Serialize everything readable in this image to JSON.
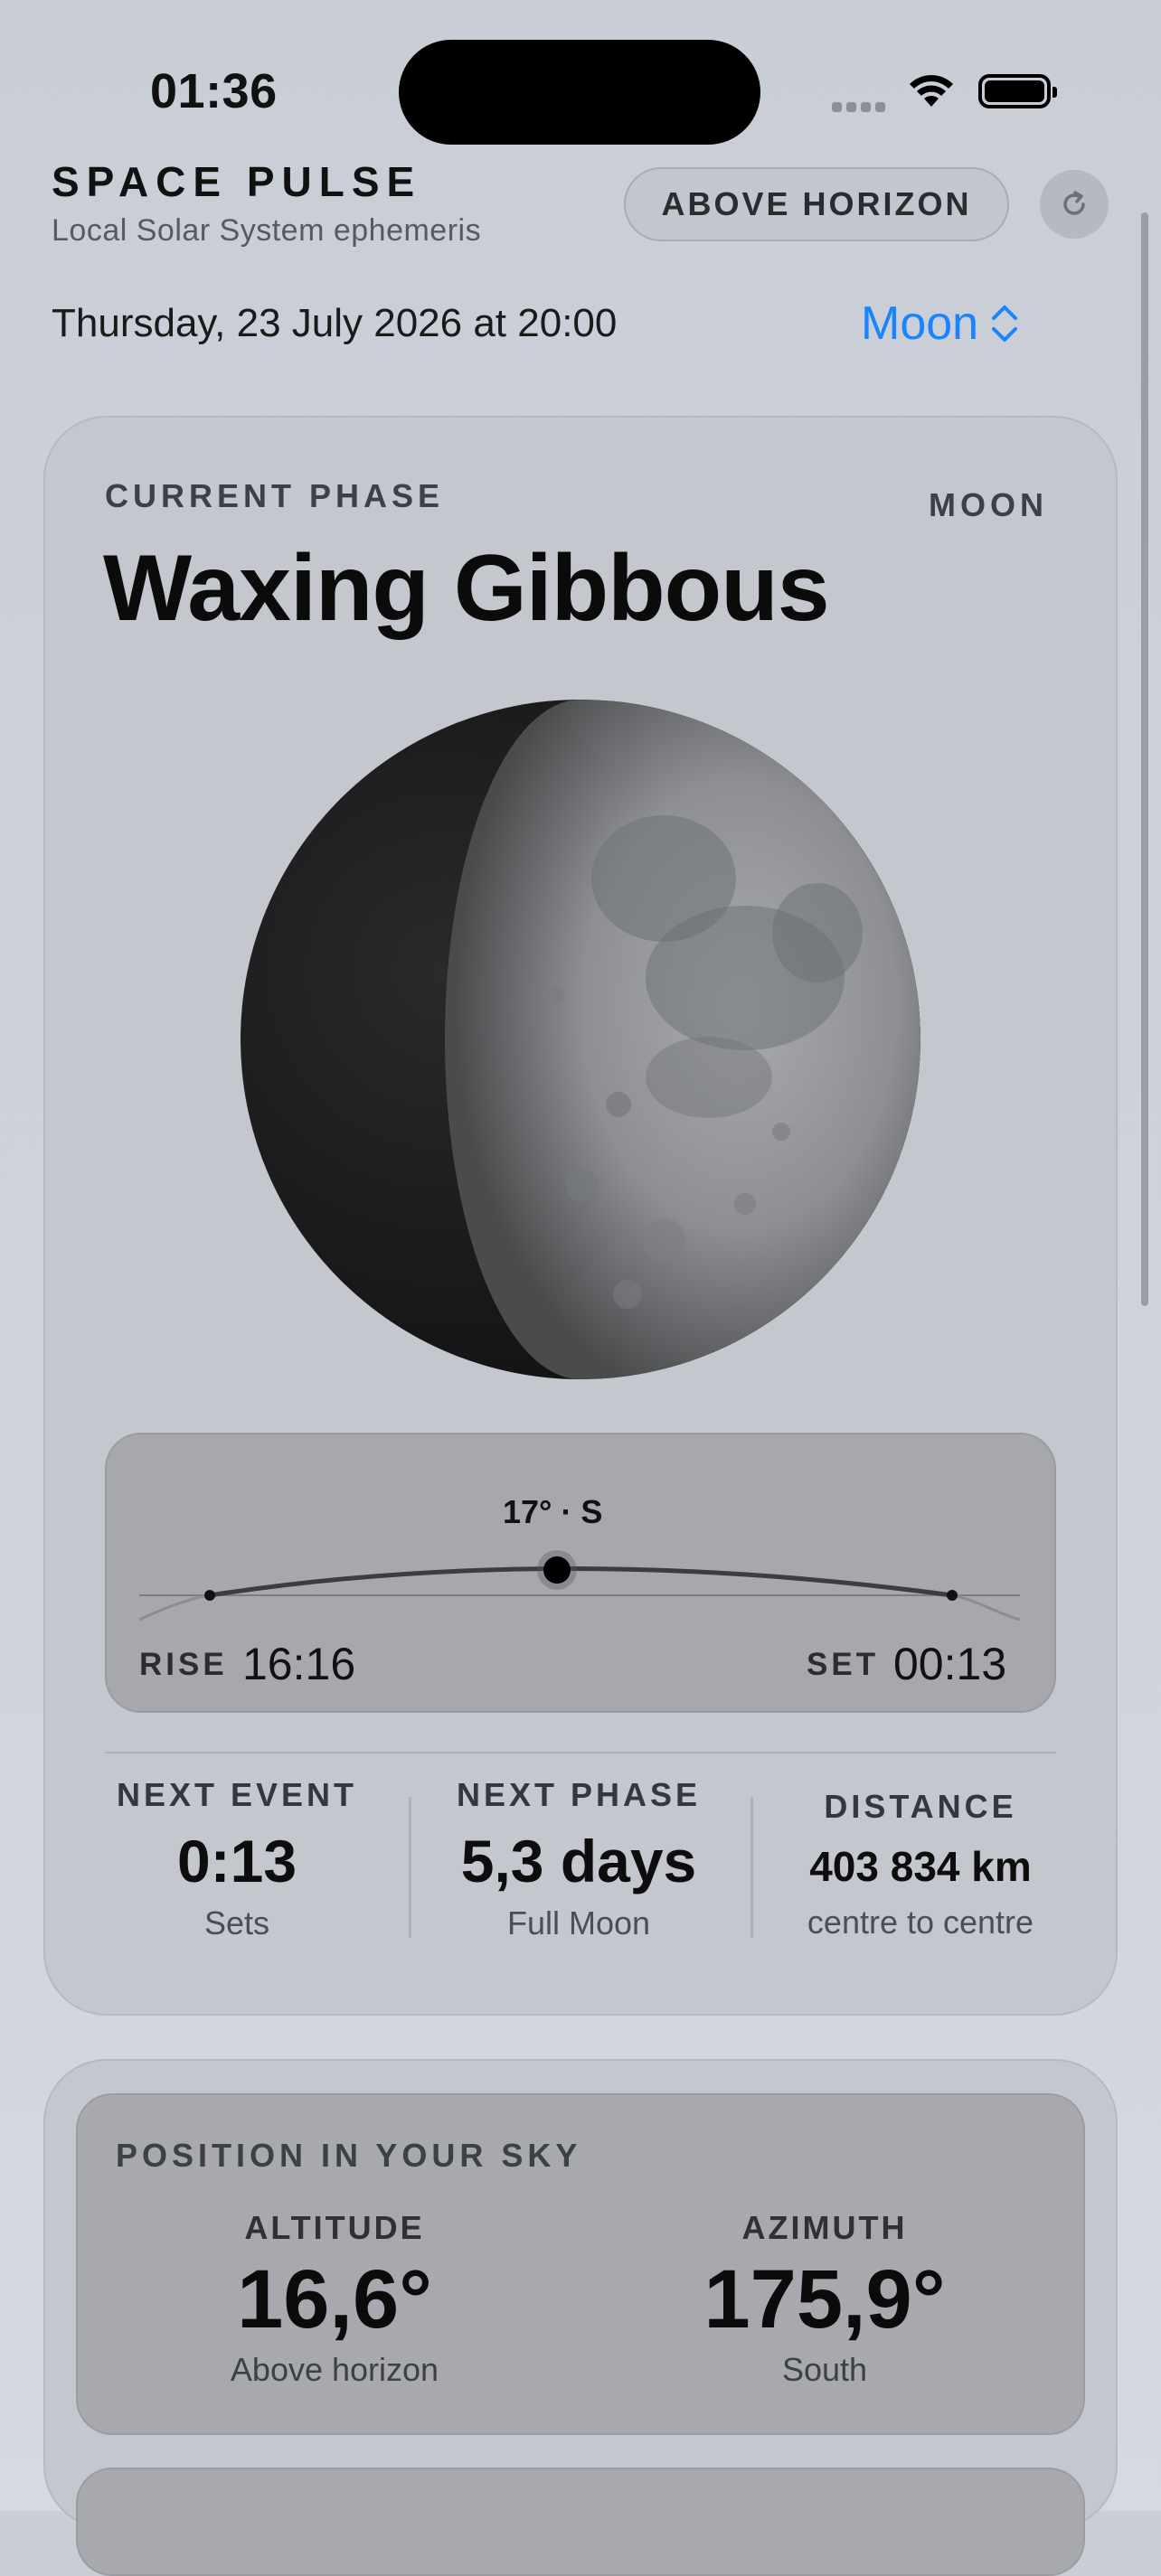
{
  "status_bar": {
    "time": "01:36"
  },
  "header": {
    "title": "SPACE PULSE",
    "subtitle": "Local Solar System ephemeris",
    "filter_button": "ABOVE HORIZON"
  },
  "toolbar": {
    "datetime": "Thursday, 23 July 2026 at 20:00",
    "body_selector": "Moon"
  },
  "phase_card": {
    "label": "CURRENT PHASE",
    "body_tag": "MOON",
    "phase_name": "Waxing Gibbous",
    "illumination_fraction": 0.7,
    "arc": {
      "peak_value": "17° · S",
      "rise_label": "RISE",
      "rise_time": "16:16",
      "set_label": "SET",
      "set_time": "00:13"
    },
    "stats": [
      {
        "key": "NEXT EVENT",
        "value": "0:13",
        "sub": "Sets"
      },
      {
        "key": "NEXT PHASE",
        "value": "5,3 days",
        "sub": "Full Moon"
      },
      {
        "key": "DISTANCE",
        "value": "403 834 km",
        "sub": "centre to centre"
      }
    ]
  },
  "position_card": {
    "title": "POSITION IN YOUR SKY",
    "altitude": {
      "key": "ALTITUDE",
      "value": "16,6°",
      "sub": "Above horizon"
    },
    "azimuth": {
      "key": "AZIMUTH",
      "value": "175,9°",
      "sub": "South"
    }
  },
  "colors": {
    "accent": "#1a84ff",
    "background": "#cdd1da",
    "card": "#c4c7ce",
    "panel": "#a6a8ae"
  },
  "icons": {
    "refresh": "refresh-icon",
    "chevron": "chevron-up-down-icon",
    "wifi": "wifi-icon",
    "battery": "battery-icon",
    "signal": "cellular-signal-icon"
  }
}
